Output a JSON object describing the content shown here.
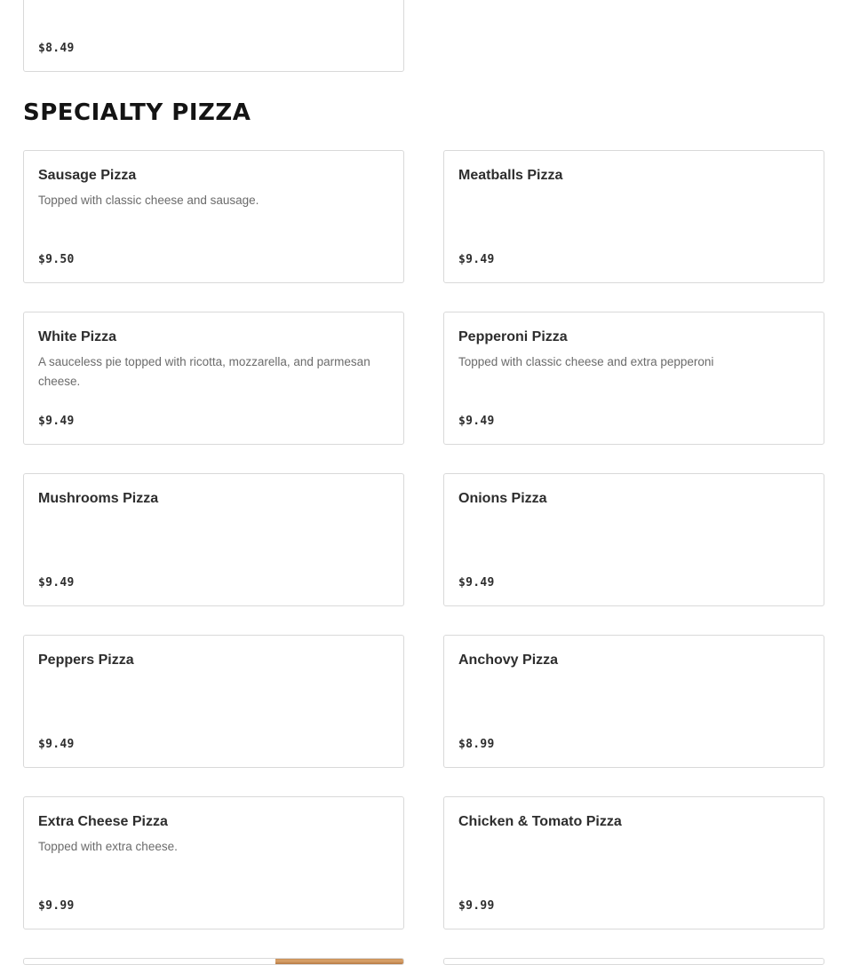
{
  "previous_item": {
    "price": "$8.49"
  },
  "section": {
    "title": "SPECIALTY PIZZA",
    "items": [
      {
        "name": "Sausage Pizza",
        "description": "Topped with classic cheese and sausage.",
        "price": "$9.50"
      },
      {
        "name": "Meatballs Pizza",
        "description": "",
        "price": "$9.49"
      },
      {
        "name": "White Pizza",
        "description": "A sauceless pie topped with ricotta, mozzarella, and parmesan cheese.",
        "price": "$9.49"
      },
      {
        "name": "Pepperoni Pizza",
        "description": "Topped with classic cheese and extra pepperoni",
        "price": "$9.49"
      },
      {
        "name": "Mushrooms Pizza",
        "description": "",
        "price": "$9.49"
      },
      {
        "name": "Onions Pizza",
        "description": "",
        "price": "$9.49"
      },
      {
        "name": "Peppers Pizza",
        "description": "",
        "price": "$9.49"
      },
      {
        "name": "Anchovy Pizza",
        "description": "",
        "price": "$8.99"
      },
      {
        "name": "Extra Cheese Pizza",
        "description": "Topped with extra cheese.",
        "price": "$9.99"
      },
      {
        "name": "Chicken & Tomato Pizza",
        "description": "",
        "price": "$9.99"
      }
    ]
  }
}
